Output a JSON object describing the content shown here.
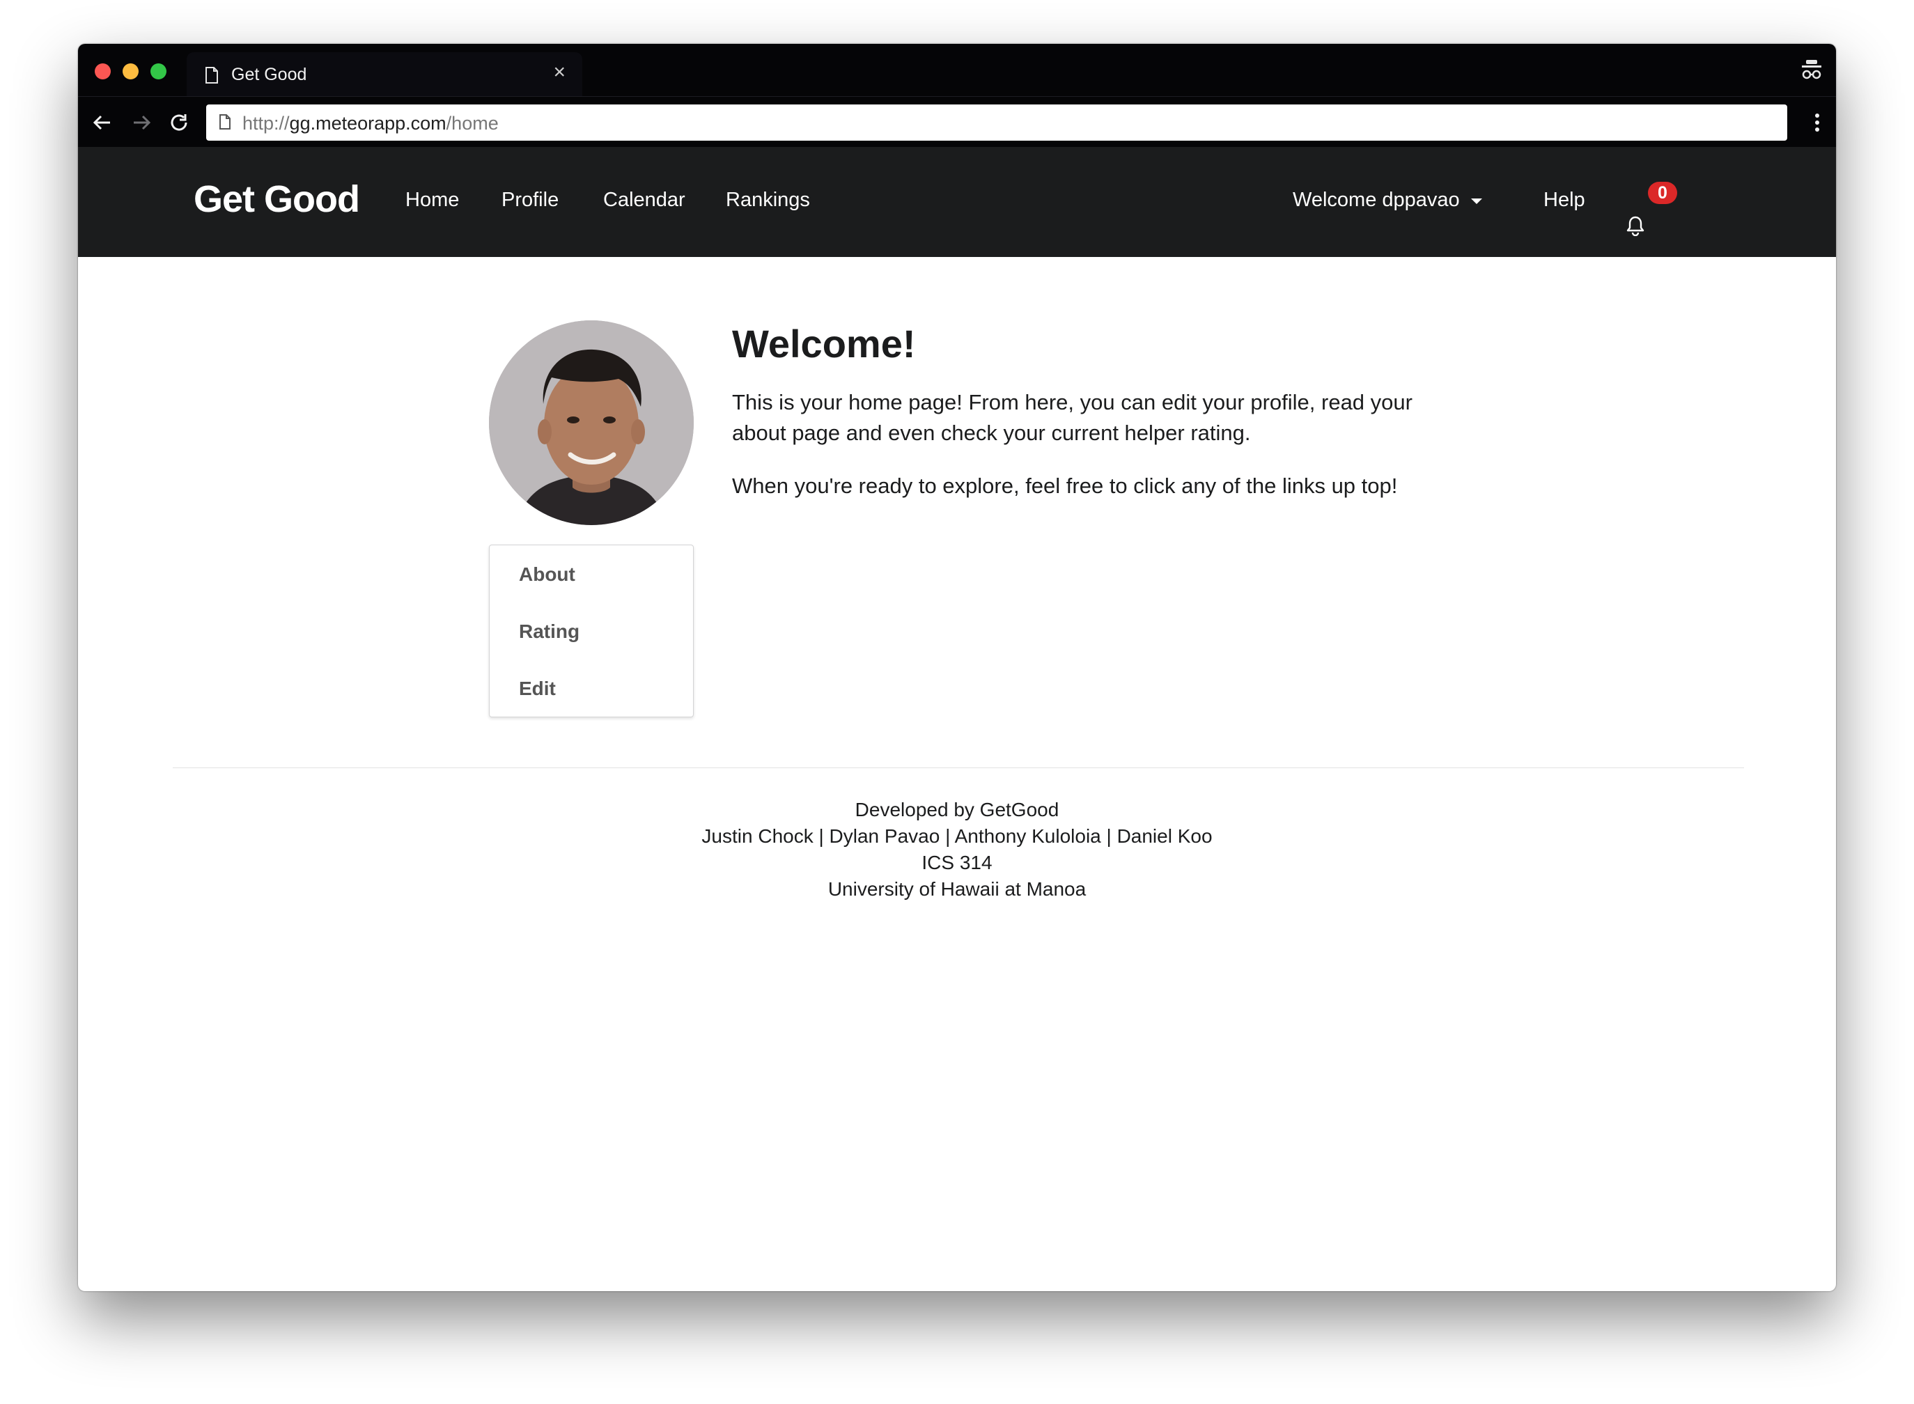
{
  "browser": {
    "tab_title": "Get Good",
    "tab_close": "×",
    "url_prefix": "http://",
    "url_host": "gg.meteorapp.com",
    "url_path": "/home"
  },
  "navbar": {
    "brand": "Get Good",
    "links": [
      "Home",
      "Profile",
      "Calendar",
      "Rankings"
    ],
    "welcome": "Welcome dppavao",
    "help": "Help",
    "notification_count": "0"
  },
  "sidebar_menu": {
    "items": [
      "About",
      "Rating",
      "Edit"
    ]
  },
  "main": {
    "title": "Welcome!",
    "intro": "This is your home page! From here, you can edit your profile, read your about page and even check your current helper rating.",
    "explore": "When you're ready to explore, feel free to click any of the links up top!"
  },
  "footer": {
    "line1": "Developed by GetGood",
    "line2": "Justin Chock | Dylan Pavao | Anthony Kuloloia | Daniel Koo",
    "line3": "ICS 314",
    "line4": "University of Hawaii at Manoa"
  },
  "colors": {
    "navbar_bg": "#1b1c1d",
    "badge_red": "#db2828",
    "chrome_bg": "#050507"
  }
}
